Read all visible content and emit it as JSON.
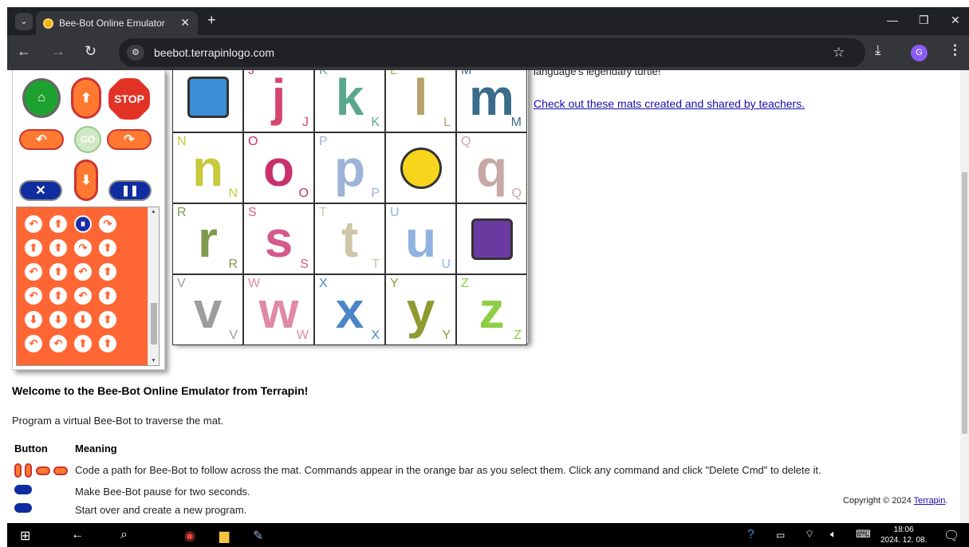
{
  "browser": {
    "tab_title": "Bee-Bot Online Emulator",
    "url": "beebot.terrapinlogo.com",
    "profile_initial": "G"
  },
  "controls": {
    "stop_label": "STOP",
    "go_label": "GO",
    "command_rows": [
      [
        "↶",
        "⬆",
        "⏸",
        "↷"
      ],
      [
        "⬆",
        "⬆",
        "↷",
        "⬆"
      ],
      [
        "↶",
        "⬆",
        "↶",
        "⬆"
      ],
      [
        "↶",
        "⬆",
        "↶",
        "⬆"
      ],
      [
        "⬇",
        "⬇",
        "⬇",
        "⬆"
      ],
      [
        "↶",
        "↶",
        "⬆",
        "⬆"
      ]
    ]
  },
  "mat": {
    "cells": [
      {
        "big": "",
        "tl": "",
        "br": "",
        "color": "#3b8fd6",
        "picture": "abc-book"
      },
      {
        "big": "j",
        "tl": "J",
        "br": "J",
        "color": "#d4466f"
      },
      {
        "big": "k",
        "tl": "K",
        "br": "K",
        "color": "#5aa88b"
      },
      {
        "big": "l",
        "tl": "L",
        "br": "L",
        "color": "#b8a06a"
      },
      {
        "big": "m",
        "tl": "M",
        "br": "M",
        "color": "#3a6c8a"
      },
      {
        "big": "n",
        "tl": "N",
        "br": "N",
        "color": "#c8c93c"
      },
      {
        "big": "o",
        "tl": "O",
        "br": "O",
        "color": "#c8316e"
      },
      {
        "big": "p",
        "tl": "P",
        "br": "P",
        "color": "#9db3d8"
      },
      {
        "big": "",
        "tl": "",
        "br": "",
        "color": "#f7d51d",
        "picture": "bee-bot"
      },
      {
        "big": "q",
        "tl": "Q",
        "br": "Q",
        "color": "#c8a7a4"
      },
      {
        "big": "r",
        "tl": "R",
        "br": "R",
        "color": "#7d9a4d"
      },
      {
        "big": "s",
        "tl": "S",
        "br": "S",
        "color": "#d45a8c"
      },
      {
        "big": "t",
        "tl": "T",
        "br": "T",
        "color": "#cfc5a8"
      },
      {
        "big": "u",
        "tl": "U",
        "br": "U",
        "color": "#8fb3e0"
      },
      {
        "big": "",
        "tl": "",
        "br": "",
        "color": "#6a3aa0",
        "picture": "teacher"
      },
      {
        "big": "v",
        "tl": "V",
        "br": "V",
        "color": "#9d9d9d"
      },
      {
        "big": "w",
        "tl": "W",
        "br": "W",
        "color": "#e08aa5"
      },
      {
        "big": "x",
        "tl": "X",
        "br": "X",
        "color": "#4a86c8"
      },
      {
        "big": "y",
        "tl": "Y",
        "br": "Y",
        "color": "#8e9a32"
      },
      {
        "big": "z",
        "tl": "Z",
        "br": "Z",
        "color": "#8ccf45"
      }
    ]
  },
  "content": {
    "intro_tail": "language's legendary turtle!",
    "teachers_link": "Check out these mats created and shared by teachers.",
    "welcome": "Welcome to the Bee-Bot Online Emulator from Terrapin!",
    "program": "Program a virtual Bee-Bot to traverse the mat.",
    "table_header_button": "Button",
    "table_header_meaning": "Meaning",
    "row1": "Code a path for Bee-Bot to follow across the mat. Commands appear in the orange bar as you select them. Click any command and click \"Delete Cmd\" to delete it.",
    "row2": "Make Bee-Bot pause for two seconds.",
    "row3": "Start over and create a new program.",
    "copyright": "Copyright © 2024",
    "terrapin_link": "Terrapin",
    "copyright_period": "."
  },
  "taskbar": {
    "time": "18:06",
    "date": "2024. 12. 08."
  }
}
